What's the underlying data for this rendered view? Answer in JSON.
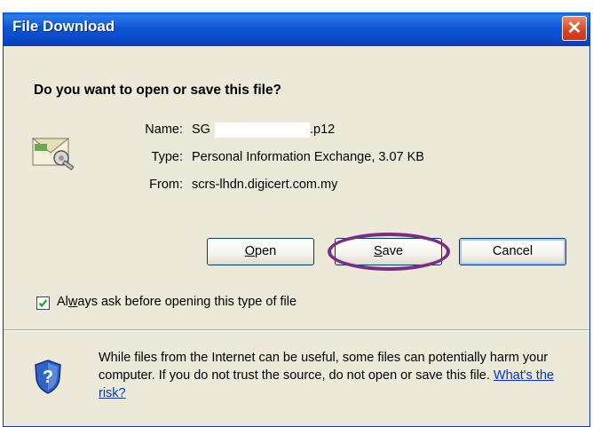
{
  "window": {
    "title": "File Download",
    "close_label": "✕"
  },
  "dialog": {
    "question": "Do you want to open or save this file?",
    "name_label": "Name:",
    "name_value_prefix": "SG",
    "name_value_suffix": ".p12",
    "type_label": "Type:",
    "type_value": "Personal Information Exchange, 3.07 KB",
    "from_label": "From:",
    "from_value": "scrs-lhdn.digicert.com.my"
  },
  "buttons": {
    "open_pre": "",
    "open_u": "O",
    "open_post": "pen",
    "save_pre": "",
    "save_u": "S",
    "save_post": "ave",
    "cancel": "Cancel"
  },
  "checkbox": {
    "checked": true,
    "label_pre": "Al",
    "label_u": "w",
    "label_post": "ays ask before opening this type of file"
  },
  "warning": {
    "text": "While files from the Internet can be useful, some files can potentially harm your computer. If you do not trust the source, do not open or save this file. ",
    "link": "What's the risk?"
  },
  "colors": {
    "titlebar": "#0a49c9",
    "dialog_bg": "#ece9d8",
    "highlight_ellipse": "#7a2d85",
    "link": "#0033cc"
  },
  "icons": [
    "certificate-file-icon",
    "security-shield-icon",
    "close-icon",
    "checkmark-icon"
  ]
}
